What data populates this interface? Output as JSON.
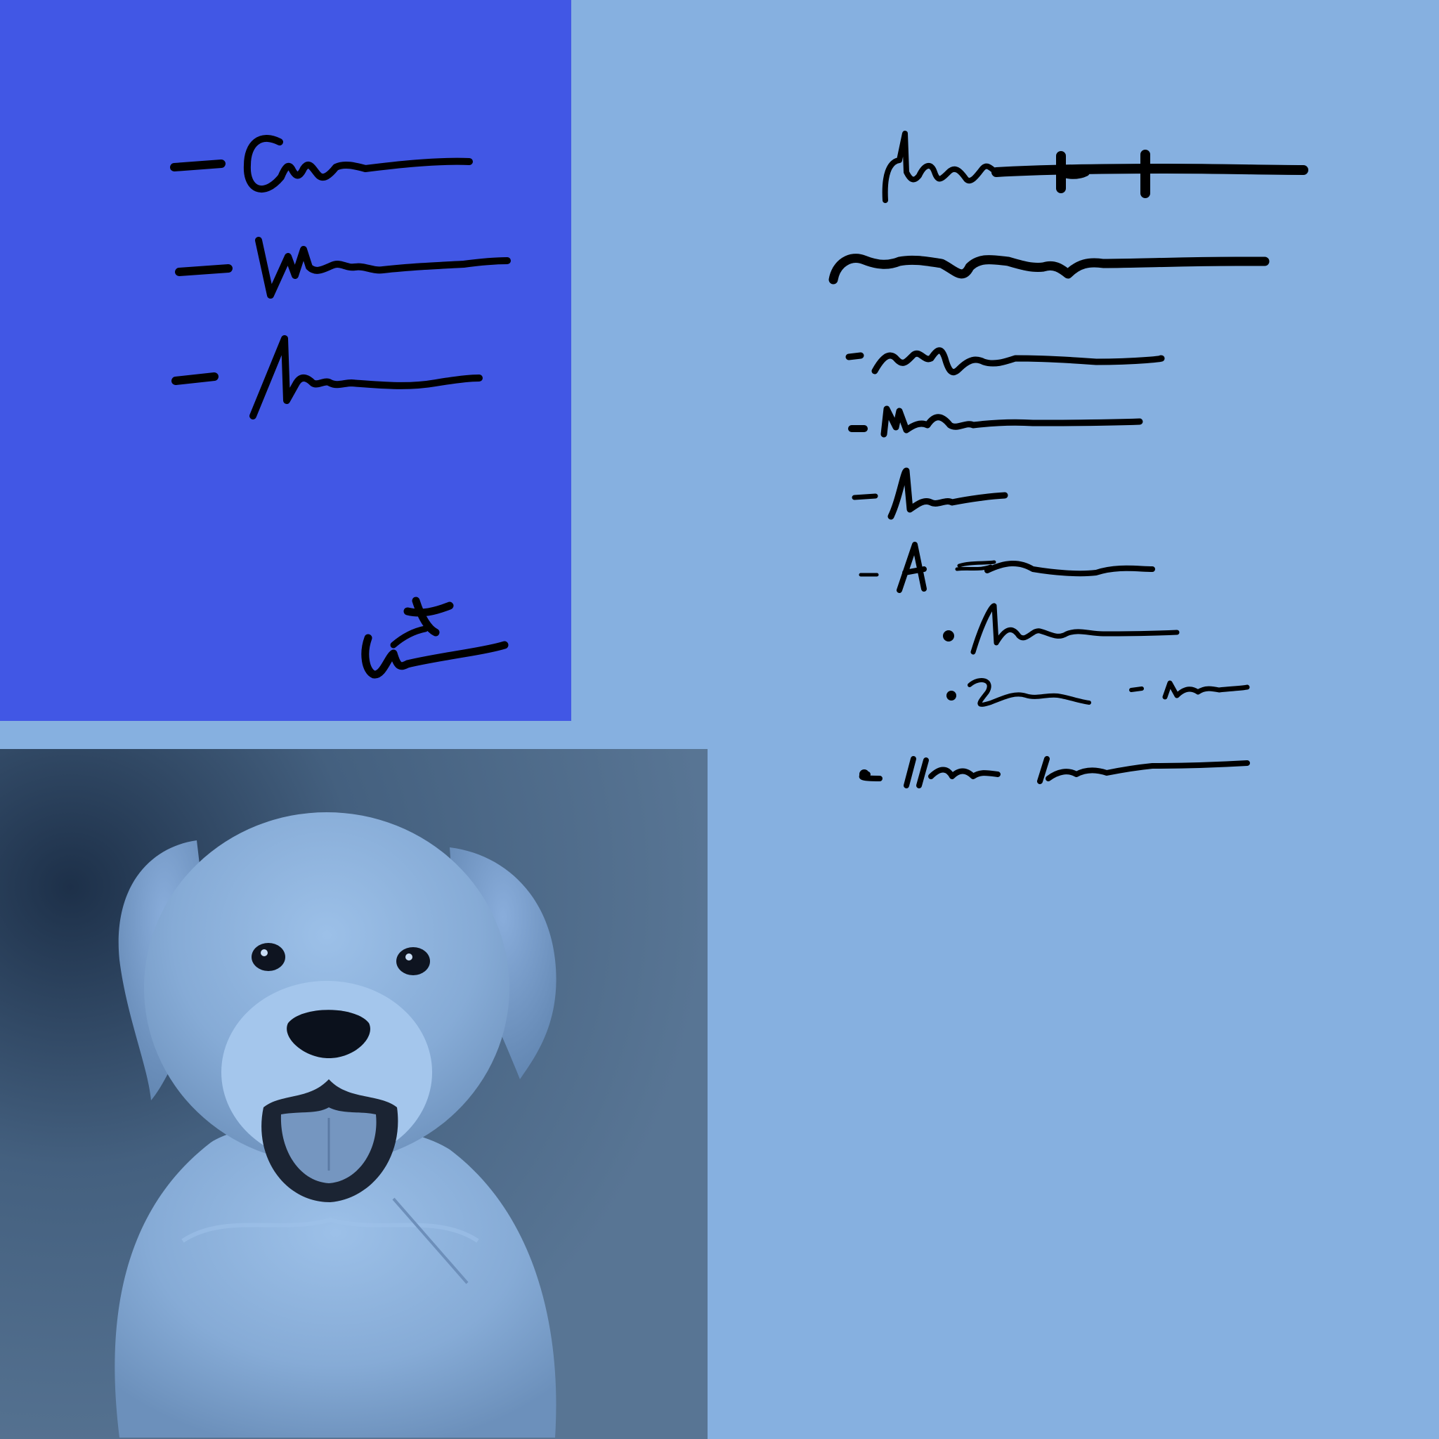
{
  "canvas": {
    "background": "#86b0e0"
  },
  "left_card": {
    "background": "#4157e5",
    "ink_color": "#000000",
    "bullet_lines": [
      {
        "kind": "dash-scribble"
      },
      {
        "kind": "dash-scribble"
      },
      {
        "kind": "dash-scribble"
      }
    ],
    "signature": {
      "kind": "handwritten-signature"
    }
  },
  "photo": {
    "subject": "puppy",
    "tint": "#7fa5d0"
  },
  "notes": {
    "ink_color": "#000000",
    "heading_lines": 2,
    "list_items": 4,
    "sub_items": 2,
    "footer_lines": 1
  }
}
